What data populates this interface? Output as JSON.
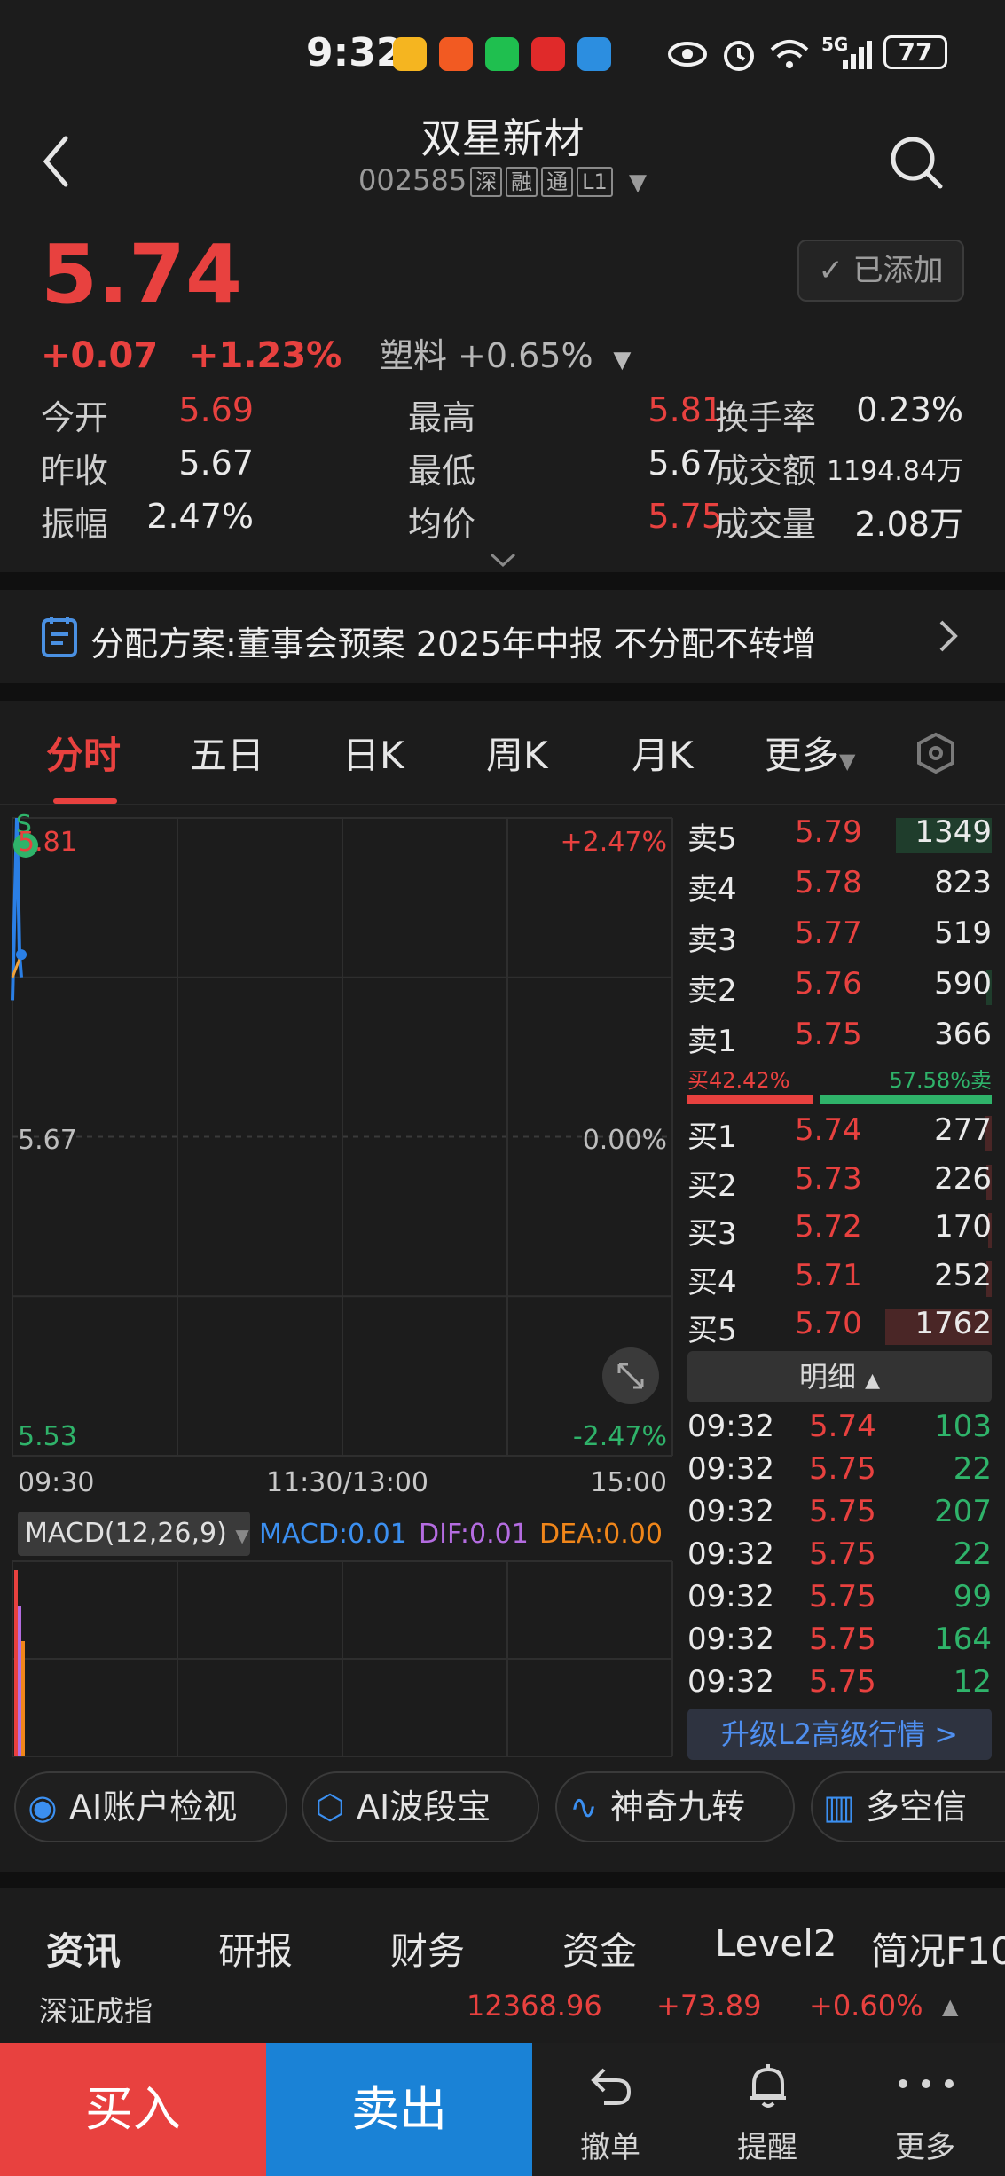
{
  "status_bar": {
    "time": "9:32",
    "battery": "77",
    "network": "5G"
  },
  "header": {
    "stock_name": "双星新材",
    "stock_code": "002585",
    "tags": [
      "深",
      "融",
      "通",
      "L1"
    ]
  },
  "quote": {
    "price": "5.74",
    "change": "+0.07",
    "change_pct": "+1.23%",
    "sector": "塑料 +0.65%",
    "added_label": "已添加",
    "grid": [
      [
        {
          "label": "今开",
          "value": "5.69",
          "color": "red"
        },
        {
          "label": "最高",
          "value": "5.81",
          "color": "red"
        },
        {
          "label": "换手率",
          "value": "0.23%",
          "color": "white"
        }
      ],
      [
        {
          "label": "昨收",
          "value": "5.67",
          "color": "white"
        },
        {
          "label": "最低",
          "value": "5.67",
          "color": "white"
        },
        {
          "label": "成交额",
          "value": "1194.84万",
          "color": "white"
        }
      ],
      [
        {
          "label": "振幅",
          "value": "2.47%",
          "color": "white"
        },
        {
          "label": "均价",
          "value": "5.75",
          "color": "red"
        },
        {
          "label": "成交量",
          "value": "2.08万",
          "color": "white"
        }
      ]
    ]
  },
  "notice": {
    "text": "分配方案:董事会预案 2025年中报 不分配不转增"
  },
  "chart_tabs": [
    "分时",
    "五日",
    "日K",
    "周K",
    "月K",
    "更多"
  ],
  "chart_data": {
    "type": "line",
    "y_labels": {
      "top": "5.81",
      "mid": "5.67",
      "bottom": "5.53"
    },
    "pct_labels": {
      "top": "+2.47%",
      "mid": "0.00%",
      "bottom": "-2.47%"
    },
    "ylim": [
      5.53,
      5.81
    ],
    "x_labels": [
      "09:30",
      "11:30/13:00",
      "15:00"
    ],
    "marker_label": "S",
    "series": [
      {
        "values": [
          5.73,
          5.81,
          5.75,
          5.74
        ]
      }
    ],
    "macd": {
      "title": "MACD(12,26,9)",
      "macd": "MACD:0.01",
      "dif": "DIF:0.01",
      "dea": "DEA:0.00"
    }
  },
  "order_book": {
    "asks": [
      {
        "label": "卖5",
        "price": "5.79",
        "vol": "1349",
        "ratio": 0.9
      },
      {
        "label": "卖4",
        "price": "5.78",
        "vol": "823",
        "ratio": 0.0
      },
      {
        "label": "卖3",
        "price": "5.77",
        "vol": "519",
        "ratio": 0.0
      },
      {
        "label": "卖2",
        "price": "5.76",
        "vol": "590",
        "ratio": 0.05
      },
      {
        "label": "卖1",
        "price": "5.75",
        "vol": "366",
        "ratio": 0.0
      }
    ],
    "buy_pct": "买42.42%",
    "sell_pct": "57.58%卖",
    "buy_ratio": 0.4242,
    "bids": [
      {
        "label": "买1",
        "price": "5.74",
        "vol": "277",
        "ratio": 0.06
      },
      {
        "label": "买2",
        "price": "5.73",
        "vol": "226",
        "ratio": 0.05
      },
      {
        "label": "买3",
        "price": "5.72",
        "vol": "170",
        "ratio": 0.03
      },
      {
        "label": "买4",
        "price": "5.71",
        "vol": "252",
        "ratio": 0.05
      },
      {
        "label": "买5",
        "price": "5.70",
        "vol": "1762",
        "ratio": 1.0
      }
    ],
    "detail_label": "明细",
    "ticks": [
      {
        "time": "09:32",
        "price": "5.74",
        "vol": "103"
      },
      {
        "time": "09:32",
        "price": "5.75",
        "vol": "22"
      },
      {
        "time": "09:32",
        "price": "5.75",
        "vol": "207"
      },
      {
        "time": "09:32",
        "price": "5.75",
        "vol": "22"
      },
      {
        "time": "09:32",
        "price": "5.75",
        "vol": "99"
      },
      {
        "time": "09:32",
        "price": "5.75",
        "vol": "164"
      },
      {
        "time": "09:32",
        "price": "5.75",
        "vol": "12"
      }
    ],
    "upgrade_label": "升级L2高级行情 >"
  },
  "shortcuts": [
    "AI账户检视",
    "AI波段宝",
    "神奇九转",
    "多空信"
  ],
  "info_tabs": [
    "资讯",
    "研报",
    "财务",
    "资金",
    "Level2",
    "简况F10"
  ],
  "index_ticker": {
    "name": "深证成指",
    "value": "12368.96",
    "change": "+73.89",
    "pct": "+0.60%"
  },
  "bottom_bar": {
    "buy": "买入",
    "sell": "卖出",
    "cancel": "撤单",
    "alert": "提醒",
    "more": "更多"
  },
  "colors": {
    "up": "#e8413f",
    "down": "#2fb36a",
    "accent": "#1a82d6",
    "bg": "#1c1c1c"
  }
}
